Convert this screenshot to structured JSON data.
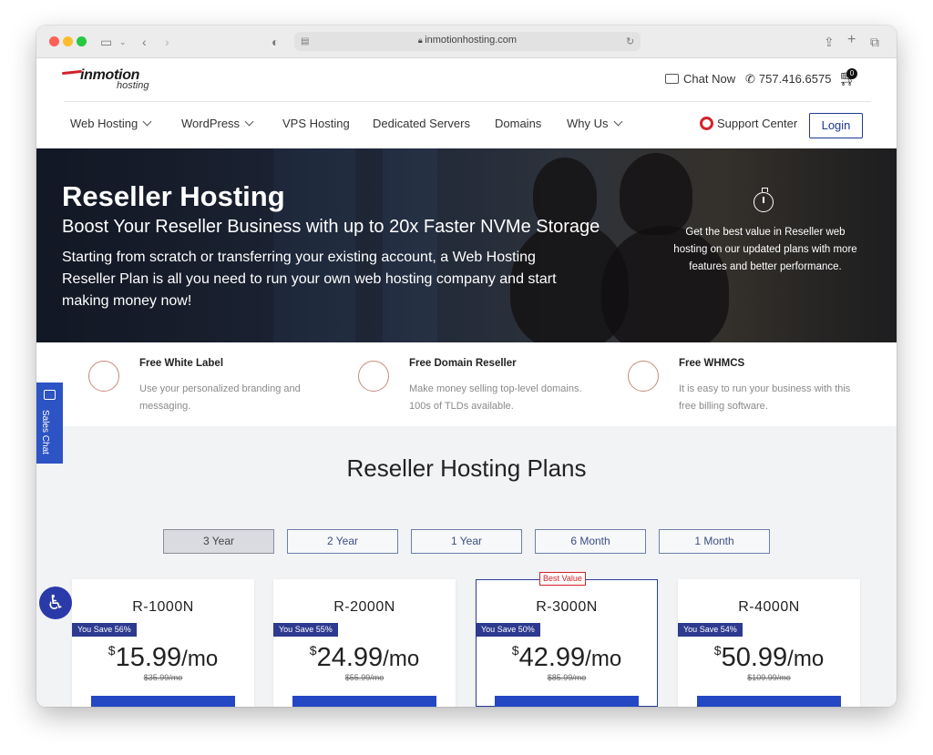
{
  "browser": {
    "url": "inmotionhosting.com"
  },
  "header": {
    "logo_main": "inmotion",
    "logo_sub": "hosting",
    "chat_label": "Chat Now",
    "phone": "757.416.6575",
    "cart_count": "0",
    "support_label": "Support Center",
    "login_label": "Login"
  },
  "nav": {
    "items": [
      {
        "label": "Web Hosting",
        "has_dropdown": true
      },
      {
        "label": "WordPress",
        "has_dropdown": true
      },
      {
        "label": "VPS Hosting",
        "has_dropdown": false
      },
      {
        "label": "Dedicated Servers",
        "has_dropdown": false
      },
      {
        "label": "Domains",
        "has_dropdown": false
      },
      {
        "label": "Why Us",
        "has_dropdown": true
      }
    ]
  },
  "hero": {
    "title": "Reseller Hosting",
    "subtitle": "Boost Your Reseller Business with up to 20x Faster NVMe Storage",
    "description": "Starting from scratch or transferring your existing account, a Web Hosting Reseller Plan is all you need to run your own web hosting company and start making money now!",
    "side_text": "Get the best value in Reseller web hosting on our updated plans with more features and better performance."
  },
  "features": [
    {
      "title": "Free White Label",
      "desc": "Use your personalized branding and messaging.",
      "icon": "handshake-icon"
    },
    {
      "title": "Free Domain Reseller",
      "desc": "Make money selling top-level domains. 100s of TLDs available.",
      "icon": "globe-icon"
    },
    {
      "title": "Free WHMCS",
      "desc": "It is easy to run your business with this free billing software.",
      "icon": "money-hand-icon"
    }
  ],
  "plans": {
    "title": "Reseller Hosting Plans",
    "terms": [
      "3 Year",
      "2 Year",
      "1 Year",
      "6 Month",
      "1 Month"
    ],
    "active_term": "3 Year",
    "best_value_label": "Best Value",
    "cards": [
      {
        "name": "R-1000N",
        "save": "You Save 56%",
        "currency": "$",
        "price": "15.99",
        "per": "/mo",
        "original": "$35.99/mo"
      },
      {
        "name": "R-2000N",
        "save": "You Save 55%",
        "currency": "$",
        "price": "24.99",
        "per": "/mo",
        "original": "$55.99/mo"
      },
      {
        "name": "R-3000N",
        "save": "You Save 50%",
        "currency": "$",
        "price": "42.99",
        "per": "/mo",
        "original": "$85.99/mo"
      },
      {
        "name": "R-4000N",
        "save": "You Save 54%",
        "currency": "$",
        "price": "50.99",
        "per": "/mo",
        "original": "$109.99/mo"
      }
    ]
  },
  "widgets": {
    "sales_chat_label": "Sales Chat"
  },
  "colors": {
    "brand_blue": "#2d3a8f",
    "accent_red": "#d2232a",
    "button_blue": "#2447c4"
  }
}
